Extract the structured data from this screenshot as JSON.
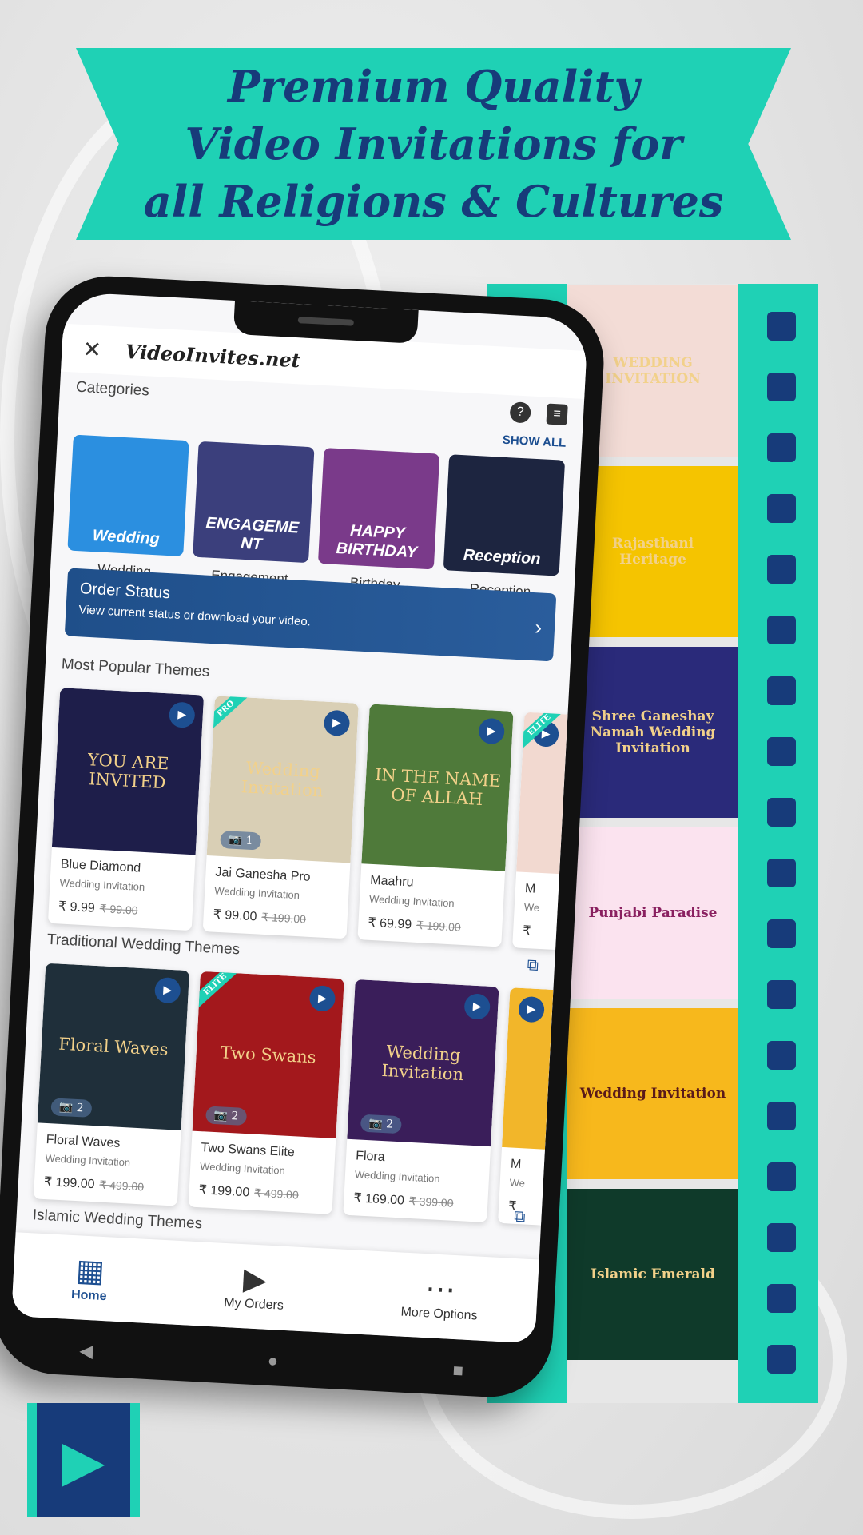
{
  "banner": {
    "lines": [
      "Premium Quality",
      "Video Invitations for",
      "all Religions & Cultures"
    ]
  },
  "app": {
    "title": "VideoInvites.net",
    "close_icon": "close-icon",
    "help_icon": "help-chat-icon",
    "list_icon": "list-icon"
  },
  "categories": {
    "title": "Categories",
    "show_all": "SHOW ALL",
    "items": [
      {
        "label": "Wedding",
        "art": "Wedding",
        "color": "#2b8fe0"
      },
      {
        "label": "Engagement",
        "art": "ENGAGEMENT",
        "color": "#3b3f7c"
      },
      {
        "label": "Birthday",
        "art": "HAPPY BIRTHDAY",
        "color": "#7a3a8a"
      },
      {
        "label": "Reception",
        "art": "Reception",
        "color": "#1d2540"
      }
    ]
  },
  "order_status": {
    "title": "Order Status",
    "subtitle": "View current status or download your video."
  },
  "popular": {
    "title": "Most Popular Themes",
    "items": [
      {
        "name": "Blue Diamond",
        "type": "Wedding Invitation",
        "price": "₹ 9.99",
        "old_price": "₹ 99.00",
        "art": "YOU ARE INVITED",
        "bg": "#1e1e4a"
      },
      {
        "name": "Jai Ganesha Pro",
        "type": "Wedding Invitation",
        "price": "₹ 99.00",
        "old_price": "₹ 199.00",
        "art": "Wedding Invitation",
        "bg": "#d9cfb5",
        "badge": "PRO",
        "photos": "1"
      },
      {
        "name": "Maahru",
        "type": "Wedding Invitation",
        "price": "₹ 69.99",
        "old_price": "₹ 199.00",
        "art": "IN THE NAME OF ALLAH",
        "bg": "#4f7a3a"
      },
      {
        "name": "M",
        "type": "We",
        "price": "₹",
        "old_price": "",
        "art": "",
        "bg": "#f2d9d0",
        "badge": "ELITE"
      }
    ]
  },
  "traditional": {
    "title": "Traditional Wedding Themes",
    "items": [
      {
        "name": "Floral Waves",
        "type": "Wedding Invitation",
        "price": "₹ 199.00",
        "old_price": "₹ 499.00",
        "art": "Floral Waves",
        "bg": "#1f2f3a",
        "photos": "2"
      },
      {
        "name": "Two Swans Elite",
        "type": "Wedding Invitation",
        "price": "₹ 199.00",
        "old_price": "₹ 499.00",
        "art": "Two Swans",
        "bg": "#a3181c",
        "badge": "ELITE",
        "photos": "2"
      },
      {
        "name": "Flora",
        "type": "Wedding Invitation",
        "price": "₹ 169.00",
        "old_price": "₹ 399.00",
        "art": "Wedding Invitation",
        "bg": "#3a1e5a",
        "photos": "2"
      },
      {
        "name": "M",
        "type": "We",
        "price": "₹",
        "old_price": "",
        "art": "",
        "bg": "#f2b62a"
      }
    ]
  },
  "islamic": {
    "title": "Islamic Wedding Themes"
  },
  "nav": [
    {
      "label": "Home",
      "icon": "grid-icon"
    },
    {
      "label": "My Orders",
      "icon": "video-icon"
    },
    {
      "label": "More Options",
      "icon": "more-icon"
    }
  ],
  "film_frames": [
    {
      "text": "WEDDING INVITATION",
      "bg": "#f3dcd6",
      "color": "#f2d18a"
    },
    {
      "text": "Rajasthani Heritage",
      "bg": "#f5c400",
      "color": "#f2d18a"
    },
    {
      "text": "Shree Ganeshay Namah Wedding Invitation",
      "bg": "#2a2a7a",
      "color": "#f2d18a"
    },
    {
      "text": "Punjabi Paradise",
      "bg": "#fbe3ef",
      "color": "#8a2060"
    },
    {
      "text": "Wedding Invitation",
      "bg": "#f7b81c",
      "color": "#5a1a1a"
    },
    {
      "text": "Islamic Emerald",
      "bg": "#0f3a2a",
      "color": "#f2d18a"
    }
  ],
  "colors": {
    "teal": "#1fd1b5",
    "navy": "#173b7a",
    "primary": "#1d4f91"
  }
}
